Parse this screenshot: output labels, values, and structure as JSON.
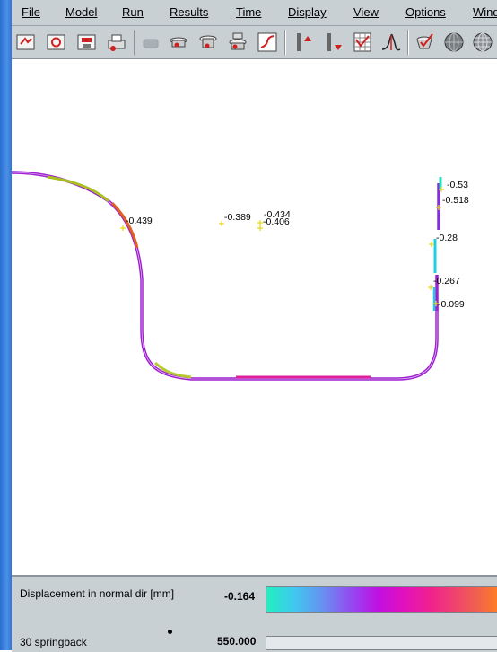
{
  "menu": [
    "File",
    "Model",
    "Run",
    "Results",
    "Time",
    "Display",
    "View",
    "Options",
    "Wind"
  ],
  "toolbar_icons": [
    "open-icon",
    "reload-icon",
    "save-icon",
    "print-icon",
    "disabled-part-icon",
    "tool-icon-1",
    "tool-icon-2",
    "tool-stack-icon",
    "tool-red-icon",
    "curve-icon",
    "axis-up-icon",
    "axis-down-icon",
    "grid-check-icon",
    "distribution-icon",
    "check-cup-icon",
    "sphere-icon",
    "mesh-sphere-icon"
  ],
  "annotations": [
    {
      "id": "a1",
      "text": "-0.439"
    },
    {
      "id": "a2",
      "text": "-0.389"
    },
    {
      "id": "a3",
      "text": "-0.434"
    },
    {
      "id": "a4",
      "text": "-0.406"
    },
    {
      "id": "a5",
      "text": "-0.53"
    },
    {
      "id": "a6",
      "text": "-0.518"
    },
    {
      "id": "a7",
      "text": "-0.28"
    },
    {
      "id": "a8",
      "text": "-0.267"
    },
    {
      "id": "a9",
      "text": "-0.099"
    }
  ],
  "panel": {
    "quantity_label": "Displacement in normal dir [mm]",
    "legend_min": "-0.164",
    "step_label": "30 springback",
    "time_value": "550.000"
  },
  "colors": {
    "profile_primary": "#a020d0",
    "profile_accent": "#e0209a",
    "marker": "#f0e020",
    "legend_start": "#20f0c0",
    "legend_end": "#ff8020"
  }
}
